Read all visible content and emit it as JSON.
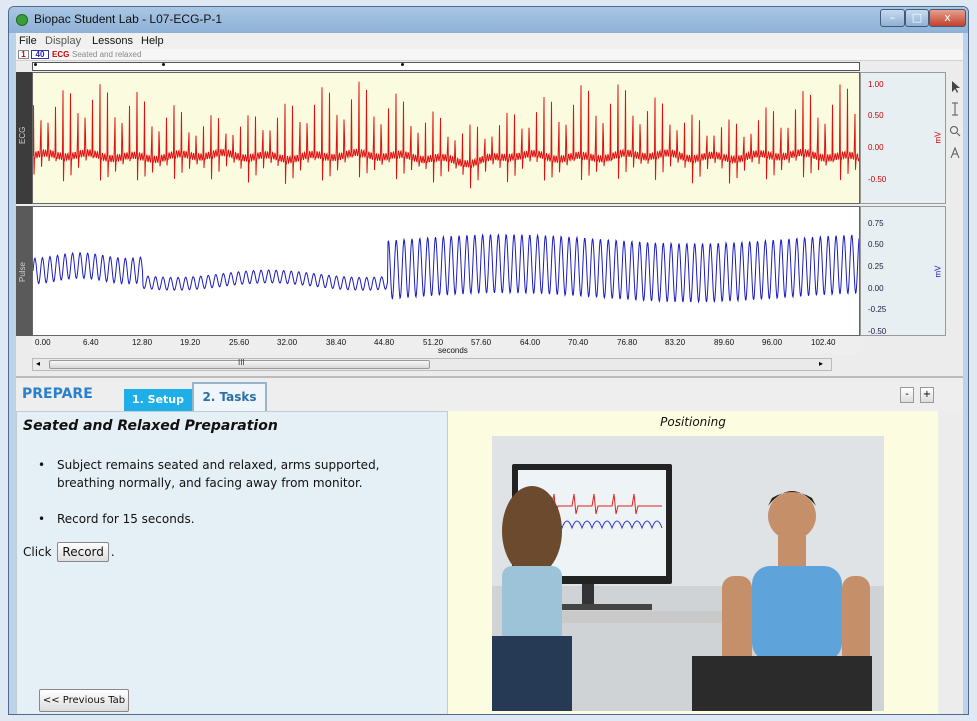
{
  "window": {
    "title": "Biopac Student Lab - L07-ECG-P-1",
    "minimize": "–",
    "maximize": "□",
    "close": "x"
  },
  "menu": [
    "File",
    "Display",
    "Lessons",
    "Help"
  ],
  "channel_bar": {
    "channel_num": "1",
    "sample": "40",
    "label": "ECG",
    "comment": "Seated and relaxed"
  },
  "ecg": {
    "label": "ECG",
    "color": "#e01010",
    "unit": "mV",
    "ticks": [
      "1.00",
      "0.50",
      "0.00",
      "-0.50"
    ],
    "range": [
      -0.65,
      1.15
    ]
  },
  "pulse": {
    "label": "Pulse",
    "color": "#1c1cc0",
    "unit": "mV",
    "ticks": [
      "0.75",
      "0.50",
      "0.25",
      "0.00",
      "-0.25",
      "-0.50"
    ],
    "range": [
      -0.55,
      0.85
    ]
  },
  "x_axis": {
    "ticks": [
      "0.00",
      "6.40",
      "12.80",
      "19.20",
      "25.60",
      "32.00",
      "38.40",
      "44.80",
      "51.20",
      "57.60",
      "64.00",
      "70.40",
      "76.80",
      "83.20",
      "89.60",
      "96.00",
      "102.40"
    ],
    "unit": "seconds"
  },
  "scrollbar": {
    "grip": "III",
    "left_arrow": "◂",
    "right_arrow": "▸"
  },
  "tools": [
    "pointer-icon",
    "ibeam-icon",
    "zoom-icon",
    "annotate-icon"
  ],
  "lesson": {
    "section": "PREPARE",
    "tabs": [
      "1. Setup",
      "2. Tasks"
    ],
    "zoom_minus": "-",
    "zoom_plus": "+",
    "heading": "Seated and Relaxed Preparation",
    "bullets": [
      "Subject remains seated and relaxed, arms supported, breathing normally, and facing away from monitor.",
      "Record for 15 seconds."
    ],
    "click_prefix": "Click",
    "record_button": "Record",
    "click_suffix": ".",
    "prev_button": "<< Previous Tab",
    "image_caption": "Positioning"
  }
}
